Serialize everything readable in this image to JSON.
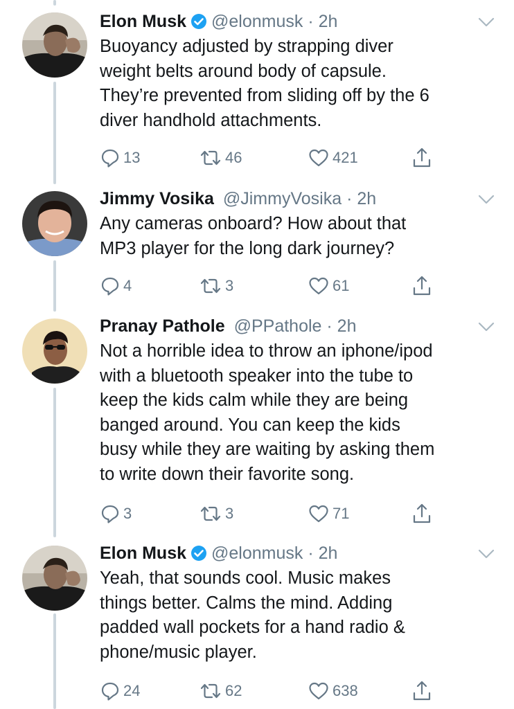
{
  "tweets": [
    {
      "name": "Elon Musk",
      "verified": true,
      "handle": "@elonmusk",
      "dot": "·",
      "time": "2h",
      "lines": [
        "Buoyancy adjusted by strapping diver",
        "weight belts around body of capsule.",
        "They’re prevented from sliding off by the 6",
        "diver handhold attachments."
      ],
      "replies": "13",
      "retweets": "46",
      "likes": "421",
      "avatar_icon": "avatar-elon-musk"
    },
    {
      "name": "Jimmy Vosika",
      "verified": false,
      "handle": "@JimmyVosika",
      "dot": "·",
      "time": "2h",
      "lines": [
        "Any cameras onboard?  How about that",
        "MP3 player for the long dark journey?"
      ],
      "replies": "4",
      "retweets": "3",
      "likes": "61",
      "avatar_icon": "avatar-jimmy-vosika"
    },
    {
      "name": "Pranay Pathole",
      "verified": false,
      "handle": "@PPathole",
      "dot": "·",
      "time": "2h",
      "lines": [
        "Not a horrible idea to throw an iphone/ipod",
        "with a bluetooth speaker into the tube to",
        "keep the kids calm while they are being",
        "banged around. You can keep the kids",
        "busy while they are waiting by asking them",
        "to write down their favorite song."
      ],
      "replies": "3",
      "retweets": "3",
      "likes": "71",
      "avatar_icon": "avatar-pranay-pathole"
    },
    {
      "name": "Elon Musk",
      "verified": true,
      "handle": "@elonmusk",
      "dot": "·",
      "time": "2h",
      "lines": [
        "Yeah, that sounds cool. Music makes",
        "things better. Calms the mind. Adding",
        "padded wall pockets for a hand radio &",
        "phone/music player."
      ],
      "replies": "24",
      "retweets": "62",
      "likes": "638",
      "avatar_icon": "avatar-elon-musk"
    }
  ],
  "colors": {
    "text": "#14171a",
    "muted": "#657786",
    "verified": "#1da1f2",
    "thread_line": "#ccd6dd"
  },
  "icons": {
    "reply": "reply-icon",
    "retweet": "retweet-icon",
    "like": "heart-icon",
    "share": "share-icon",
    "more": "chevron-down-icon",
    "verified": "verified-badge-icon"
  }
}
